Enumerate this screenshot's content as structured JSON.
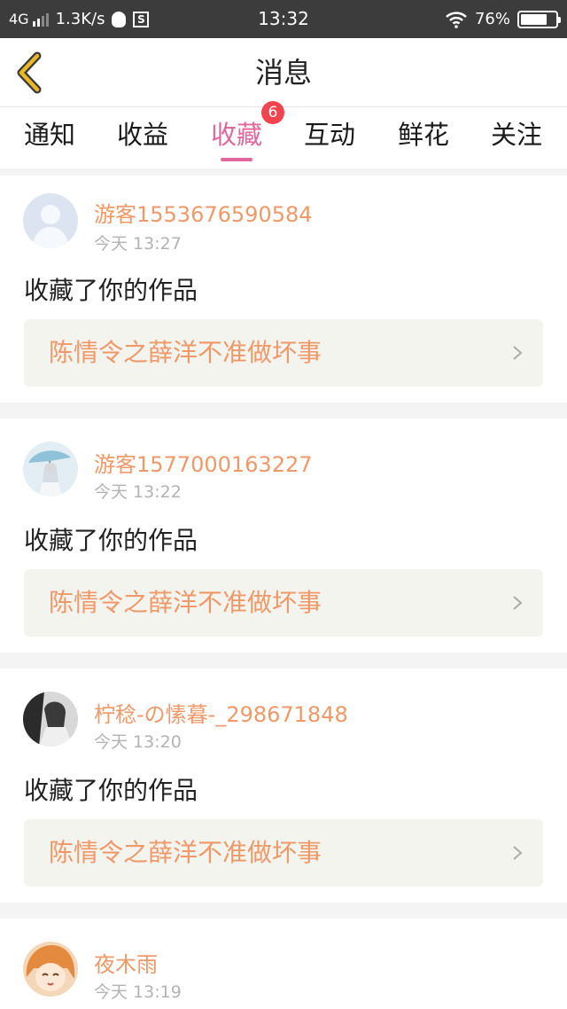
{
  "status_bar": {
    "network": "4G",
    "speed": "1.3K/s",
    "time": "13:32",
    "battery": "76%",
    "battery_level": 0.76
  },
  "header": {
    "title": "消息"
  },
  "tabs": [
    {
      "label": "通知"
    },
    {
      "label": "收益"
    },
    {
      "label": "收藏",
      "badge": "6",
      "active": true
    },
    {
      "label": "互动"
    },
    {
      "label": "鲜花"
    },
    {
      "label": "关注"
    }
  ],
  "messages": [
    {
      "username": "游客1553676590584",
      "time": "今天 13:27",
      "action": "收藏了你的作品",
      "work_title": "陈情令之薛洋不准做坏事",
      "avatar_icon": "default-user-avatar"
    },
    {
      "username": "游客1577000163227",
      "time": "今天 13:22",
      "action": "收藏了你的作品",
      "work_title": "陈情令之薛洋不准做坏事",
      "avatar_icon": "anime-girl-umbrella-avatar"
    },
    {
      "username": "柠稔-の愫暮-_298671848",
      "time": "今天 13:20",
      "action": "收藏了你的作品",
      "work_title": "陈情令之薛洋不准做坏事",
      "avatar_icon": "black-white-photo-avatar"
    },
    {
      "username": "夜木雨",
      "time": "今天 13:19",
      "avatar_icon": "orange-hair-anime-avatar"
    }
  ],
  "colors": {
    "accent_pink": "#e2679d",
    "username_orange": "#ef9868",
    "badge_red": "#f2444f",
    "back_arrow_yellow": "#e8b923"
  }
}
